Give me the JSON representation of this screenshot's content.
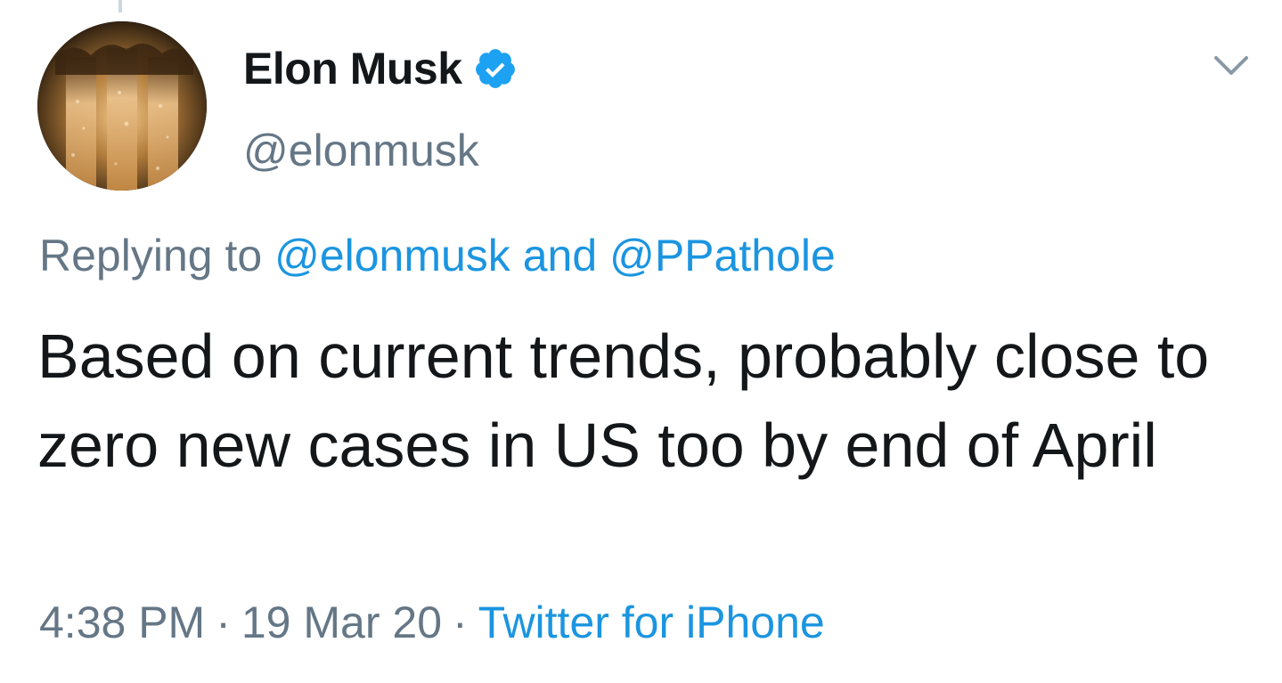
{
  "author": {
    "display_name": "Elon Musk",
    "handle": "@elonmusk",
    "verified": true,
    "verified_icon": "verified-badge-icon"
  },
  "menu": {
    "icon": "chevron-down-icon"
  },
  "reply": {
    "prefix": "Replying to",
    "mention_1": "@elonmusk",
    "conjunction": "and",
    "mention_2": "@PPathole"
  },
  "tweet": {
    "text": "Based on current trends, probably close to zero new cases in US too by end of April"
  },
  "meta": {
    "time": "4:38 PM",
    "separator": "·",
    "date": "19 Mar 20",
    "source": "Twitter for iPhone"
  },
  "colors": {
    "link": "#1b95e0",
    "secondary_text": "#657786",
    "primary_text": "#14171a",
    "verified": "#1da1f2"
  }
}
